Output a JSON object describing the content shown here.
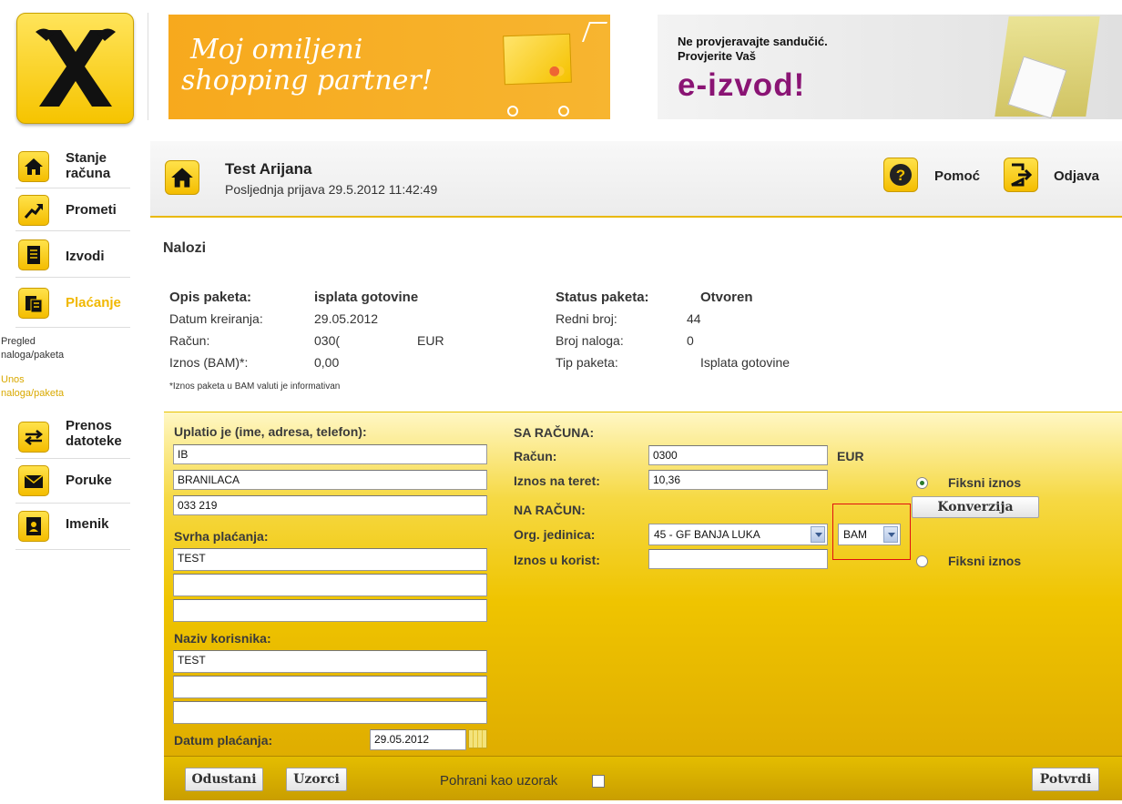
{
  "banners": {
    "shopping": {
      "line1": "Moj omiljeni",
      "line2": "shopping partner!"
    },
    "eizvod": {
      "line1": "Ne provjeravajte sandučić.",
      "line2": "Provjerite Vaš",
      "big": "e-izvod!"
    }
  },
  "sidebar": {
    "items": [
      {
        "label1": "Stanje",
        "label2": "računa",
        "icon": "home-icon"
      },
      {
        "label1": "Prometi",
        "icon": "trend-icon"
      },
      {
        "label1": "Izvodi",
        "icon": "document-icon"
      },
      {
        "label1": "Plaćanje",
        "icon": "payment-icon"
      },
      {
        "label1": "Prenos",
        "label2": "datoteke",
        "icon": "transfer-icon"
      },
      {
        "label1": "Poruke",
        "icon": "envelope-icon"
      },
      {
        "label1": "Imenik",
        "icon": "addressbook-icon"
      }
    ],
    "sub": [
      {
        "line1": "Pregled",
        "line2": "naloga/paketa"
      },
      {
        "line1": "Unos",
        "line2": "naloga/paketa"
      }
    ]
  },
  "header": {
    "user": "Test Arijana",
    "last_login": "Posljednja prijava 29.5.2012 11:42:49",
    "help": "Pomoć",
    "logout": "Odjava"
  },
  "section_title": "Nalozi",
  "package": {
    "desc_label": "Opis paketa:",
    "desc_value": "isplata gotovine",
    "date_label": "Datum kreiranja:",
    "date_value": "29.05.2012",
    "account_label": "Račun:",
    "account_value": "030(",
    "account_currency": "EUR",
    "amount_label": "Iznos (BAM)*:",
    "amount_value": "0,00",
    "status_label": "Status paketa:",
    "status_value": "Otvoren",
    "ordinal_label": "Redni broj:",
    "ordinal_value": "44",
    "count_label": "Broj naloga:",
    "count_value": "0",
    "type_label": "Tip paketa:",
    "type_value": "Isplata gotovine",
    "note": "*Iznos paketa u BAM valuti je informativan"
  },
  "form": {
    "payer_label": "Uplatio je (ime, adresa, telefon):",
    "payer_lines": [
      "IB",
      "BRANILACA",
      "033 219"
    ],
    "purpose_label": "Svrha plaćanja:",
    "purpose_lines": [
      "TEST",
      "",
      ""
    ],
    "recipient_label": "Naziv korisnika:",
    "recipient_lines": [
      "TEST",
      "",
      ""
    ],
    "date_label": "Datum plaćanja:",
    "date_value": "29.05.2012",
    "from_label": "SA RAČUNA:",
    "from_account_label": "Račun:",
    "from_account_value": "0300",
    "from_currency": "EUR",
    "debit_label": "Iznos na teret:",
    "debit_value": "10,36",
    "to_label": "NA RAČUN:",
    "org_label": "Org. jedinica:",
    "org_value": "45 - GF BANJA LUKA",
    "currency_value": "BAM",
    "credit_label": "Iznos u korist:",
    "credit_value": "",
    "fixed1": "Fiksni iznos",
    "fixed2": "Fiksni iznos",
    "convert": "Konverzija"
  },
  "footer": {
    "cancel": "Odustani",
    "templates": "Uzorci",
    "save_template": "Pohrani kao uzorak",
    "confirm": "Potvrdi"
  },
  "colors": {
    "accent": "#f4c200",
    "plum": "#8a1474",
    "highlight": "#e01010"
  }
}
